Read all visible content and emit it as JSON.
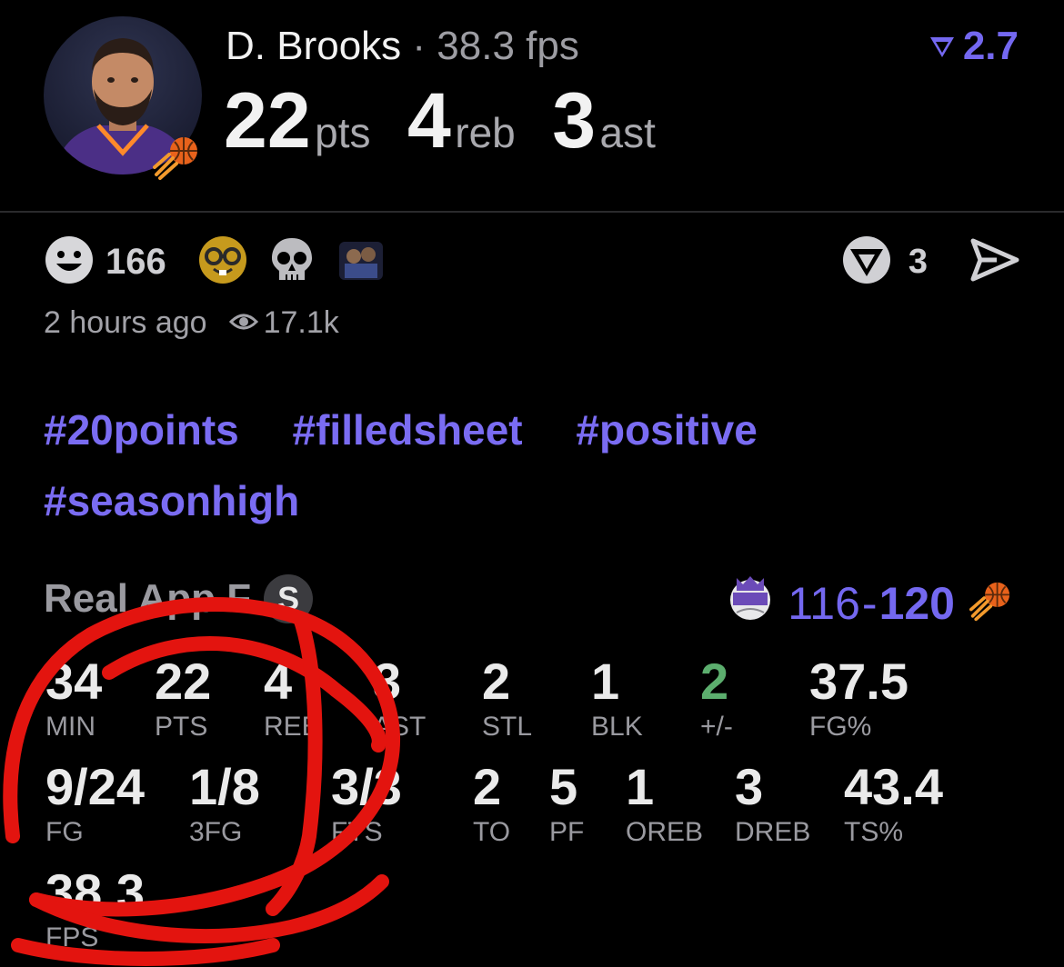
{
  "player": {
    "name": "D. Brooks",
    "separator": "·",
    "fps": "38.3 fps",
    "pts_value": "22",
    "pts_unit": "pts",
    "reb_value": "4",
    "reb_unit": "reb",
    "ast_value": "3",
    "ast_unit": "ast"
  },
  "header_score": "2.7",
  "reactions": {
    "smiley_count": "166",
    "share_count": "3"
  },
  "meta": {
    "time_ago": "2 hours ago",
    "views": "17.1k"
  },
  "hashtags": [
    "#20points",
    "#filledsheet",
    "#positive",
    "#seasonhigh"
  ],
  "game": {
    "label": "Real App F",
    "badge": "S",
    "score_away": "116",
    "score_dash": "-",
    "score_home": "120"
  },
  "stats_row1": [
    {
      "value": "34",
      "label": "MIN"
    },
    {
      "value": "22",
      "label": "PTS"
    },
    {
      "value": "4",
      "label": "REB"
    },
    {
      "value": "3",
      "label": "AST"
    },
    {
      "value": "2",
      "label": "STL"
    },
    {
      "value": "1",
      "label": "BLK"
    },
    {
      "value": "2",
      "label": "+/-"
    },
    {
      "value": "37.5",
      "label": "FG%"
    }
  ],
  "stats_row2": [
    {
      "value": "9/24",
      "label": "FG"
    },
    {
      "value": "1/8",
      "label": "3FG"
    },
    {
      "value": "3/3",
      "label": "FTS"
    },
    {
      "value": "2",
      "label": "TO"
    },
    {
      "value": "5",
      "label": "PF"
    },
    {
      "value": "1",
      "label": "OREB"
    },
    {
      "value": "3",
      "label": "DREB"
    },
    {
      "value": "43.4",
      "label": "TS%"
    }
  ],
  "stats_row3": [
    {
      "value": "38.3",
      "label": "FPS"
    }
  ],
  "colors": {
    "accent": "#7468f0",
    "positive": "#5cae6e",
    "annotation": "#e3140f"
  },
  "icons": [
    "smiley-icon",
    "nerd-emoji-icon",
    "skull-emoji-icon",
    "sticker-icon",
    "league-logo-icon",
    "send-icon",
    "eye-icon",
    "kings-logo-icon",
    "suns-logo-icon"
  ]
}
